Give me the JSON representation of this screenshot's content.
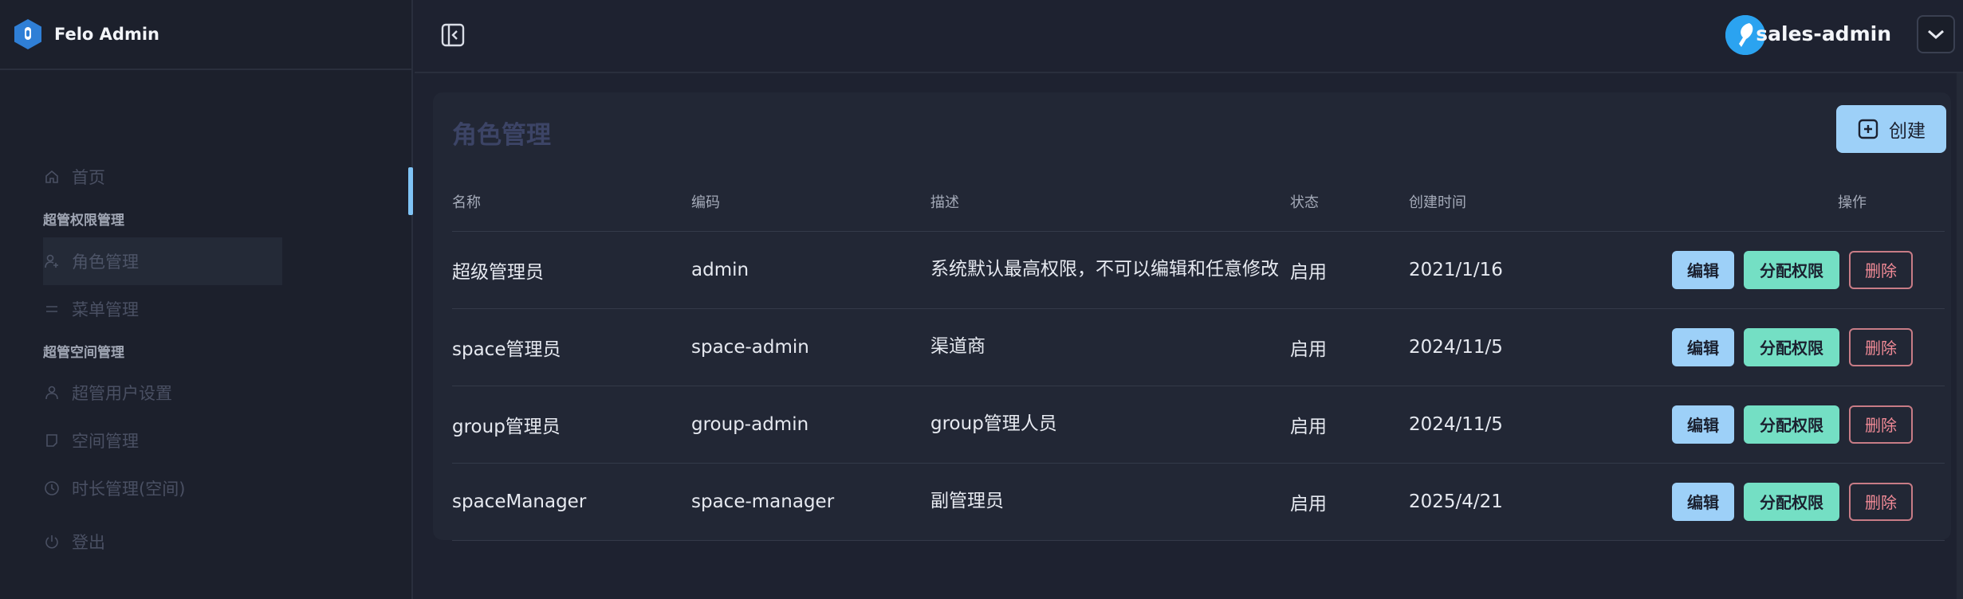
{
  "app": {
    "brand_name": "Felo Admin"
  },
  "sidebar": {
    "items": [
      {
        "label": "首页",
        "icon": "home-icon"
      },
      {
        "group": "超管权限管理"
      },
      {
        "label": "角色管理",
        "icon": "user-plus-icon",
        "active": true
      },
      {
        "label": "菜单管理",
        "icon": "menu-lines-icon"
      },
      {
        "group": "超管空间管理"
      },
      {
        "label": "超管用户设置",
        "icon": "user-icon"
      },
      {
        "label": "空间管理",
        "icon": "bookmark-icon"
      },
      {
        "label": "时长管理(空间)",
        "icon": "clock-icon"
      },
      {
        "label": "登出",
        "icon": "power-icon"
      }
    ],
    "home": "首页",
    "group1": "超管权限管理",
    "role": "角色管理",
    "menu": "菜单管理",
    "group2": "超管空间管理",
    "users": "超管用户设置",
    "space": "空间管理",
    "duration": "时长管理(空间)",
    "logout": "登出"
  },
  "header": {
    "username": "sales-admin"
  },
  "main": {
    "title": "角色管理",
    "create_label": "创建",
    "columns": {
      "name": "名称",
      "code": "编码",
      "desc": "描述",
      "status": "状态",
      "time": "创建时间",
      "ops": "操作"
    },
    "rows": [
      {
        "name": "超级管理员",
        "code": "admin",
        "desc": "系统默认最高权限，不可以编辑和任意修改",
        "status": "启用",
        "time": "2021/1/16"
      },
      {
        "name": "space管理员",
        "code": "space-admin",
        "desc": "渠道商",
        "status": "启用",
        "time": "2024/11/5"
      },
      {
        "name": "group管理员",
        "code": "group-admin",
        "desc": "group管理人员",
        "status": "启用",
        "time": "2024/11/5"
      },
      {
        "name": "spaceManager",
        "code": "space-manager",
        "desc": "副管理员",
        "status": "启用",
        "time": "2025/4/21"
      }
    ],
    "actions": {
      "edit": "编辑",
      "perm": "分配权限",
      "delete": "删除"
    }
  },
  "colors": {
    "accent_blue": "#9dd0f8",
    "accent_teal": "#74dfc4",
    "danger": "#f08a96",
    "background": "#1e2230"
  }
}
